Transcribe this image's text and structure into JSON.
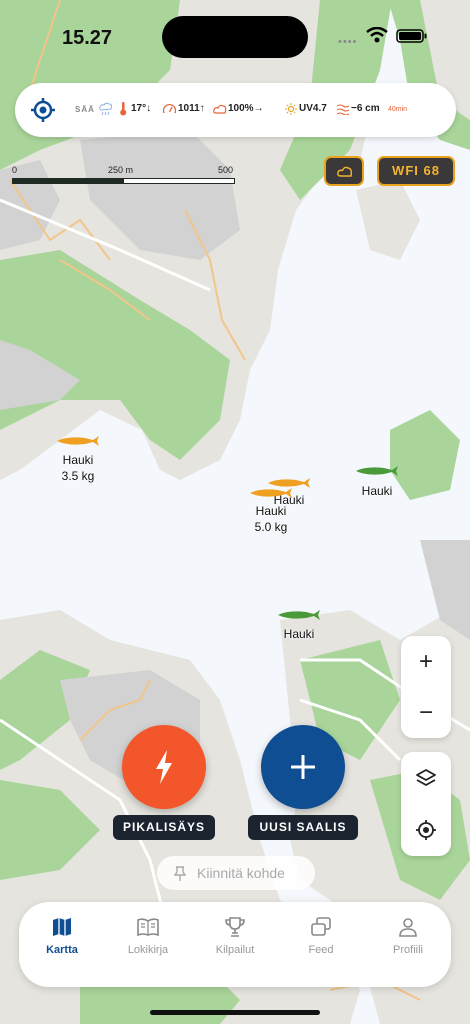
{
  "status_bar": {
    "time": "15.27",
    "dots": "••••"
  },
  "weather": {
    "label": "SÄÄ",
    "temperature": "17°↓",
    "pressure": "1011↑",
    "clouds": "100%→",
    "uv": "UV4.7",
    "water_level": "−6 cm",
    "age": "40min"
  },
  "scale": {
    "start": "0",
    "mid": "250 m",
    "end": "500 m"
  },
  "map_buttons": {
    "wfi": "WFI 68"
  },
  "catches": [
    {
      "species": "Hauki",
      "weight": "3.5 kg",
      "color": "#f0a020"
    },
    {
      "species": "Hauki",
      "weight": "",
      "color": "#f0a020"
    },
    {
      "species": "Hauki",
      "weight": "",
      "color": "#4a9a3a"
    },
    {
      "species": "Hauki",
      "weight": "5.0 kg",
      "color": "#f0a020"
    },
    {
      "species": "Hauki",
      "weight": "",
      "color": "#4a9a3a"
    }
  ],
  "zoom": {
    "in": "+",
    "out": "−"
  },
  "actions": {
    "quick_label": "PIKALISÄYS",
    "new_label": "UUSI SAALIS"
  },
  "pin": {
    "label": "Kiinnitä kohde"
  },
  "tabs": [
    {
      "label": "Kartta",
      "icon": "map-icon",
      "active": true
    },
    {
      "label": "Lokikirja",
      "icon": "book-icon",
      "active": false
    },
    {
      "label": "Kilpailut",
      "icon": "trophy-icon",
      "active": false
    },
    {
      "label": "Feed",
      "icon": "feed-icon",
      "active": false
    },
    {
      "label": "Profiili",
      "icon": "person-icon",
      "active": false
    }
  ],
  "colors": {
    "land": "#e6e4de",
    "forest": "#a9d59a",
    "water": "#f4f7fb",
    "road": "#f2c58a",
    "accent": "#0f4e93",
    "quick": "#f2562a",
    "wfi": "#f4b431"
  }
}
